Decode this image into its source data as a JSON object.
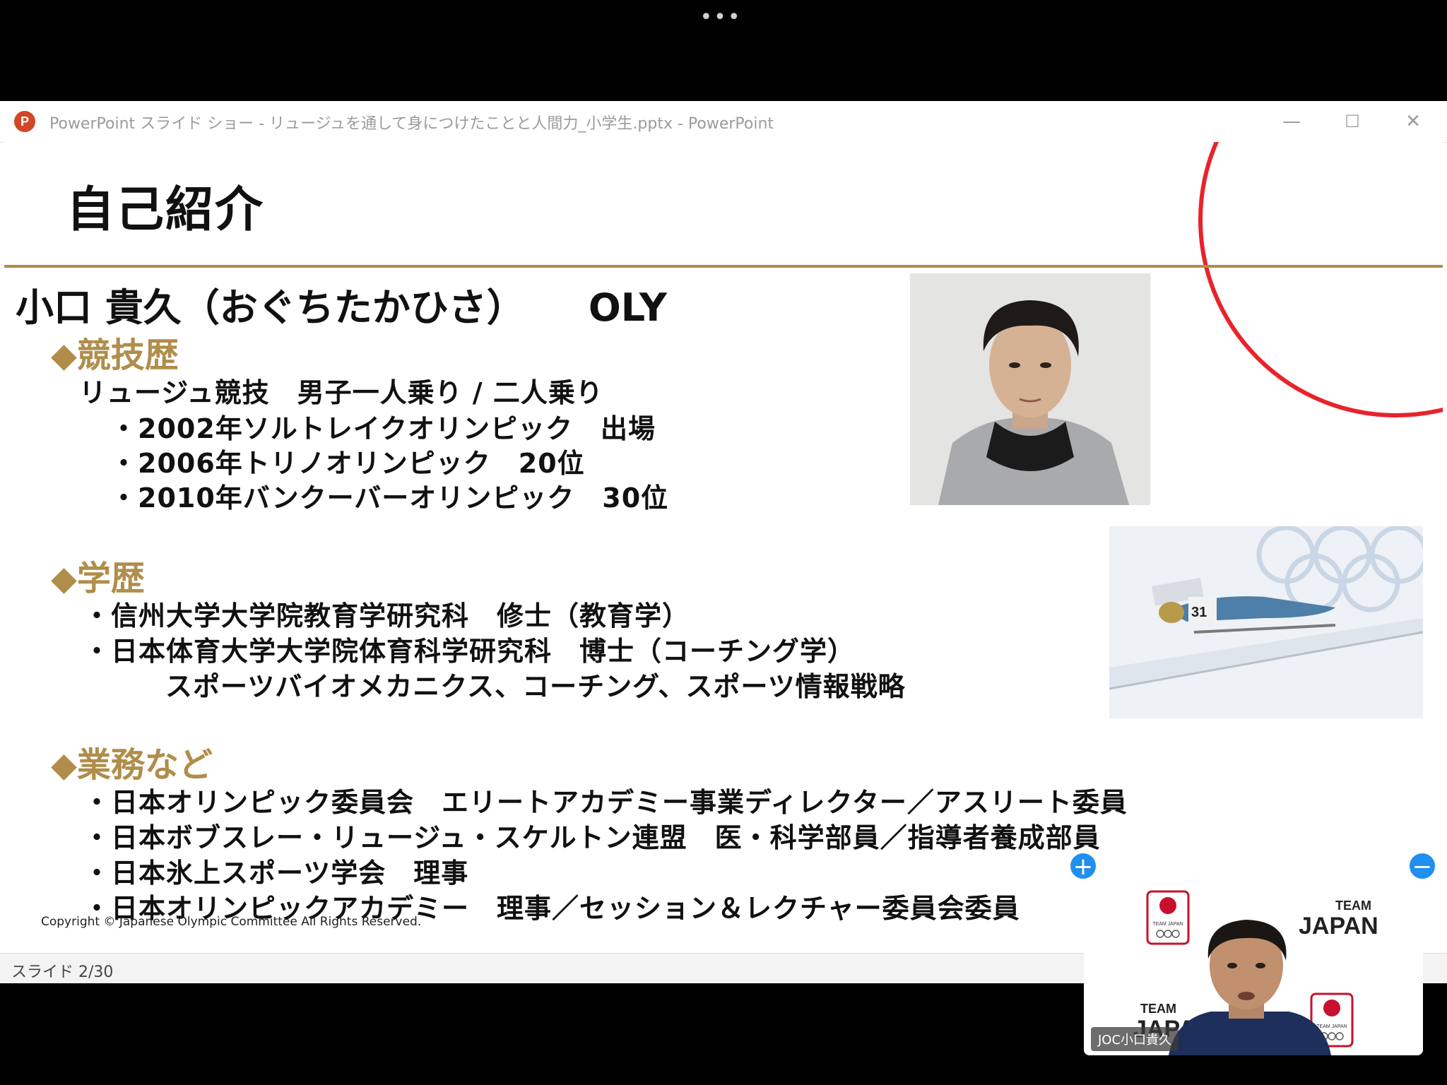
{
  "top": {
    "dots": "•••"
  },
  "window": {
    "icon_letter": "P",
    "title": "PowerPoint スライド ショー  -  リュージュを通して身につけたことと人間力_小学生.pptx - PowerPoint",
    "minimize": "—",
    "maximize": "☐",
    "close": "✕"
  },
  "slide": {
    "title": "自己紹介",
    "name": "小口 貴久（おぐちたかひさ）",
    "oly": "OLY",
    "sections": [
      {
        "heading": "◆競技歴",
        "lines": [
          "リュージュ競技　男子一人乗り / 二人乗り",
          "・2002年ソルトレイクオリンピック　出場",
          "・2006年トリノオリンピック　20位",
          "・2010年バンクーバーオリンピック　30位"
        ]
      },
      {
        "heading": "◆学歴",
        "lines": [
          "・信州大学大学院教育学研究科　修士（教育学）",
          "・日本体育大学大学院体育科学研究科　博士（コーチング学）",
          "スポーツバイオメカニクス、コーチング、スポーツ情報戦略"
        ]
      },
      {
        "heading": "◆業務など",
        "lines": [
          "・日本オリンピック委員会　エリートアカデミー事業ディレクター／アスリート委員",
          "・日本ボブスレー・リュージュ・スケルトン連盟　医・科学部員／指導者養成部員",
          "・日本氷上スポーツ学会　理事",
          "・日本オリンピックアカデミー　理事／セッション＆レクチャー委員会委員"
        ]
      }
    ],
    "luge_bib": "31",
    "copyright": "Copyright © Japanese Olympic Committee All Rights Reserved."
  },
  "status": {
    "slide_counter": "スライド 2/30"
  },
  "video": {
    "participant_label": "JOC小口貴久",
    "bg_team": "TEAM",
    "bg_japan": "JAPAN",
    "emblem_text": "TEAM JAPAN",
    "zoom_in": "+",
    "zoom_out": "−"
  },
  "colors": {
    "gold": "#b08d4a",
    "accent_red": "#e8232b",
    "control_blue": "#1f8ff0"
  }
}
